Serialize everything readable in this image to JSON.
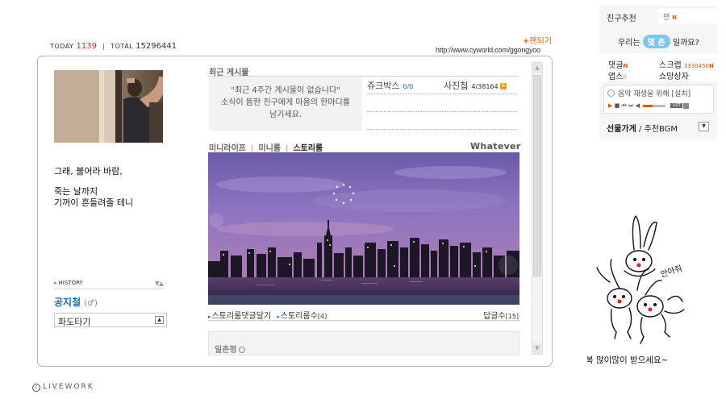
{
  "counter": {
    "today_label": "TODAY",
    "today_value": "1139",
    "total_label": "TOTAL",
    "total_value": "15296441"
  },
  "header": {
    "fan_link": "팬되기",
    "url": "http://www.cyworld.com/ggongyoo"
  },
  "profile": {
    "lines": [
      "그래, 불어라 바람,",
      "죽는 날까지",
      "기꺼이 흔들려줄 테니"
    ],
    "history_label": "HISTORY",
    "owner_name": "공지철",
    "gender_mark": "(♂)",
    "wave_select": "파도타기"
  },
  "recent": {
    "title": "최근 게시물",
    "message_line1": "\"최근 4주간 게시물이 없습니다\"",
    "message_line2": "소식이 뜸한 친구에게 마음의 한마디를",
    "message_line3": "남기세요.",
    "jukebox_label": "쥬크박스",
    "jukebox_count": "0/0",
    "photo_label": "사진첩",
    "photo_count": "4/38164",
    "new_badge": "N"
  },
  "story": {
    "tabs": [
      "미니라이프",
      "미니룸",
      "스토리룸"
    ],
    "active_tab": "스토리룸",
    "caption": "Whatever",
    "link_reply": "스토리룸댓글달기",
    "link_count_label": "스토리룸수",
    "link_count": "[4]",
    "reply_label": "답글수",
    "reply_count": "[15]"
  },
  "guestbook": {
    "title": "일촌평"
  },
  "footer": {
    "logo": "LIVEWORK",
    "copyright_mark": "c"
  },
  "right_panel": {
    "friend_recommend": "친구추천",
    "fan_label": "팬",
    "new_mark": "N",
    "question_prefix": "우리는",
    "question_pill": "몇 촌",
    "question_suffix": "일까요?",
    "comment_label": "댓글",
    "scrap_label": "스크랩",
    "scrap_count": "3330456",
    "apps_label": "앱스",
    "apps_count": "0",
    "shopping_label": "쇼망상자",
    "player_text": "음악 재생을 위해 [설치]",
    "list_label": "LIST",
    "gift_bold": "선물가게",
    "gift_rest": " / 추천BGM",
    "doodle_text": "복 많이많이 받으세요~",
    "doodle_speech": "안아줘"
  },
  "colors": {
    "accent_red": "#d2232a",
    "link_blue": "#1b6fb6",
    "orange": "#e15a00",
    "pill_blue": "#7ec6ee"
  }
}
